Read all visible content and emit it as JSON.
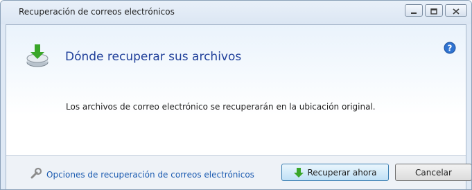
{
  "window": {
    "title": "Recuperación de correos electrónicos"
  },
  "caption_buttons": {
    "minimize_icon": "minimize-icon",
    "maximize_icon": "maximize-icon",
    "close_icon": "close-icon"
  },
  "header": {
    "title": "Dónde recuperar sus archivos",
    "icon": "restore-drive-icon",
    "help_icon": "help-icon"
  },
  "body": {
    "message": "Los archivos de correo electrónico se recuperarán en la ubicación original."
  },
  "footer": {
    "options_link": "Opciones de recuperación de correos electrónicos",
    "options_icon": "wrench-icon",
    "recover_button": "Recuperar ahora",
    "cancel_button": "Cancelar"
  },
  "colors": {
    "accent": "#1f3f9a",
    "link": "#1a5ab0",
    "icon_green": "#3aa629"
  }
}
